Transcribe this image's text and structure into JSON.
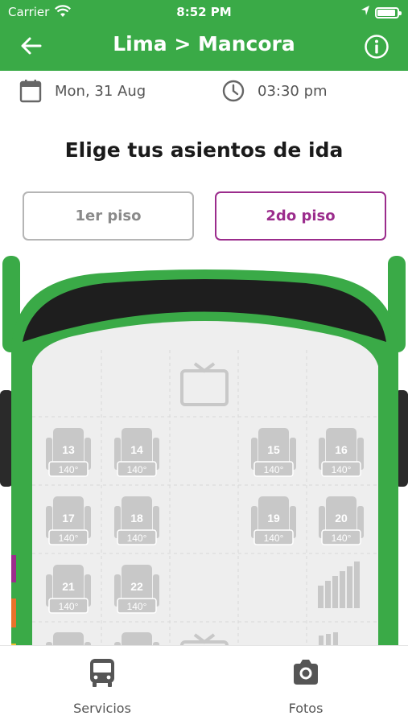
{
  "status_bar": {
    "carrier": "Carrier",
    "time": "8:52 PM"
  },
  "header": {
    "title": "Lima > Mancora",
    "back_icon": "arrow-left-icon",
    "info_icon": "info-icon"
  },
  "trip": {
    "date": "Mon, 31 Aug",
    "time": "03:30 pm",
    "date_icon": "calendar-icon",
    "time_icon": "clock-icon"
  },
  "heading": "Elige tus asientos de ida",
  "floors": {
    "first": "1er piso",
    "second": "2do piso",
    "selected": "second"
  },
  "seats": [
    {
      "number": "13",
      "angle": "140°"
    },
    {
      "number": "14",
      "angle": "140°"
    },
    {
      "number": "15",
      "angle": "140°"
    },
    {
      "number": "16",
      "angle": "140°"
    },
    {
      "number": "17",
      "angle": "140°"
    },
    {
      "number": "18",
      "angle": "140°"
    },
    {
      "number": "19",
      "angle": "140°"
    },
    {
      "number": "20",
      "angle": "140°"
    },
    {
      "number": "21",
      "angle": "140°"
    },
    {
      "number": "22",
      "angle": "140°"
    }
  ],
  "tabs": [
    {
      "label": "Servicios",
      "icon": "bus-icon"
    },
    {
      "label": "Fotos",
      "icon": "camera-icon"
    }
  ],
  "colors": {
    "primary": "#3aaa47",
    "accent": "#9b2c8c",
    "seat": "#c8c8c8"
  }
}
